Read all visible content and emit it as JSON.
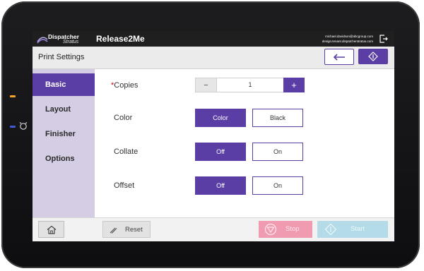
{
  "header": {
    "logo_word": "Dispatcher",
    "logo_sub": "Stratus",
    "app_name": "Release2Me",
    "user_email": "michael.davidson@abcgroup.com",
    "user_server": "design.tenant.dispatcherstratus.com"
  },
  "titlebar": {
    "title": "Print Settings"
  },
  "sidebar": {
    "items": [
      {
        "label": "Basic"
      },
      {
        "label": "Layout"
      },
      {
        "label": "Finisher"
      },
      {
        "label": "Options"
      }
    ]
  },
  "settings": {
    "copies": {
      "required_mark": "*",
      "label": "Copies",
      "minus": "−",
      "value": "1",
      "plus": "+"
    },
    "color": {
      "label": "Color",
      "options": [
        "Color",
        "Black"
      ],
      "selected": "Color"
    },
    "collate": {
      "label": "Collate",
      "options": [
        "Off",
        "On"
      ],
      "selected": "Off"
    },
    "offset": {
      "label": "Offset",
      "options": [
        "Off",
        "On"
      ],
      "selected": "Off"
    }
  },
  "footer": {
    "reset_label": "Reset",
    "stop_label": "Stop",
    "start_label": "Start"
  },
  "colors": {
    "accent": "#5a3ea6",
    "sidebar": "#d4cde3",
    "stop": "#f19bb0",
    "start": "#b4dbe8"
  }
}
